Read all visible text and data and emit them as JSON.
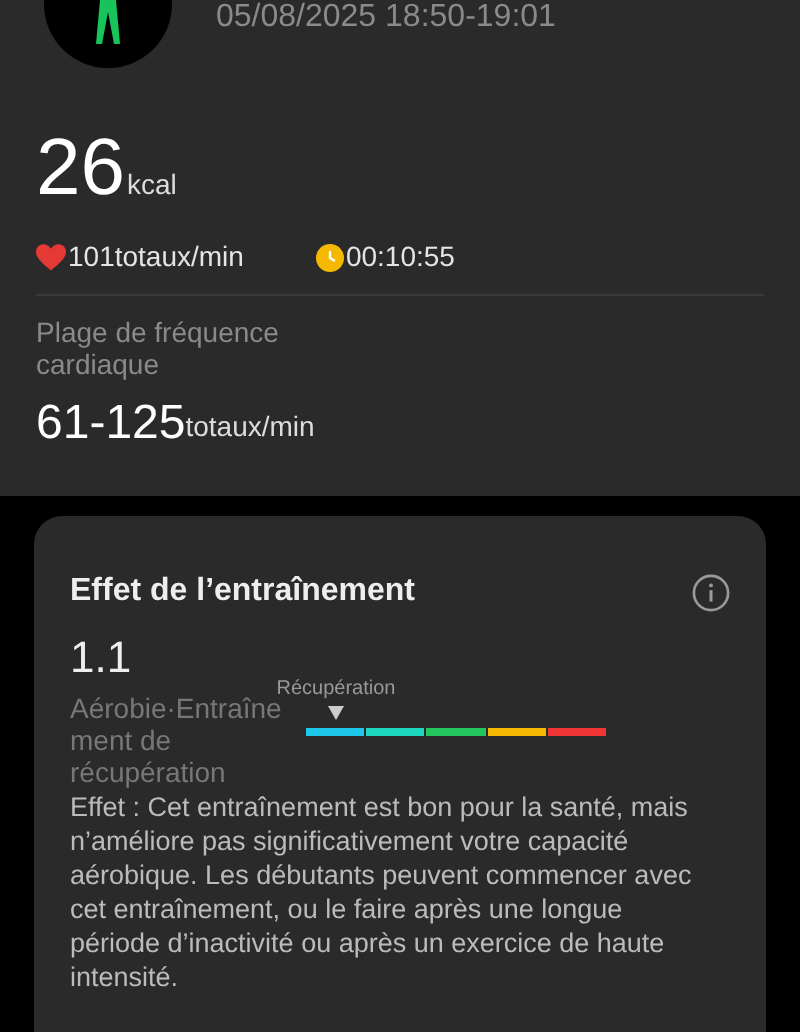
{
  "header": {
    "datetime": "05/08/2025 18:50-19:01"
  },
  "calories": {
    "value": "26",
    "unit": "kcal"
  },
  "stats": [
    {
      "kind": "heart",
      "text": "101totaux/min"
    },
    {
      "kind": "clock",
      "text": "00:10:55"
    }
  ],
  "heart_rate_range": {
    "label": "Plage de fréquence cardiaque",
    "value": "61-125",
    "unit": "totaux/min"
  },
  "training_effect": {
    "title": "Effet de l’entraînement",
    "score": "1.1",
    "type": "Aérobie·Entraînement de récupération",
    "scale_label": "Récupération",
    "level": 0.1,
    "segments": [
      {
        "color": "#1ec8e8"
      },
      {
        "color": "#1ed8c0"
      },
      {
        "color": "#22c55e"
      },
      {
        "color": "#f5b800"
      },
      {
        "color": "#ef3434"
      }
    ],
    "description": "Effet : Cet entraînement est bon pour la santé, mais n’améliore pas significativement votre capacité aérobique. Les débutants peuvent commencer avec cet entraînement, ou le faire après une longue période d’inactivité ou après un exercice de haute intensité."
  }
}
